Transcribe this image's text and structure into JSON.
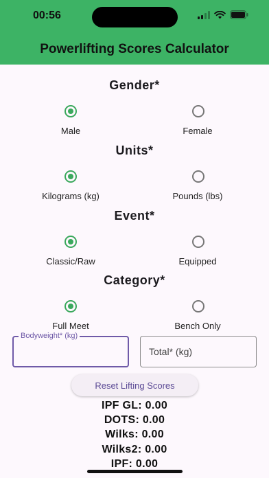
{
  "status": {
    "time": "00:56"
  },
  "app": {
    "title": "Powerlifting Scores Calculator"
  },
  "gender": {
    "title": "Gender*",
    "options": [
      "Male",
      "Female"
    ],
    "selected": "Male"
  },
  "units": {
    "title": "Units*",
    "options": [
      "Kilograms (kg)",
      "Pounds (lbs)"
    ],
    "selected": "Kilograms (kg)"
  },
  "event": {
    "title": "Event*",
    "options": [
      "Classic/Raw",
      "Equipped"
    ],
    "selected": "Classic/Raw"
  },
  "category": {
    "title": "Category*",
    "options": [
      "Full Meet",
      "Bench Only"
    ],
    "selected": "Full Meet"
  },
  "inputs": {
    "bodyweight": {
      "label": "Bodyweight* (kg)",
      "value": ""
    },
    "total": {
      "label": "Total* (kg)",
      "value": ""
    }
  },
  "reset_label": "Reset Lifting Scores",
  "scores": [
    "IPF GL: 0.00",
    "DOTS: 0.00",
    "Wilks: 0.00",
    "Wilks2: 0.00",
    "IPF: 0.00"
  ],
  "colors": {
    "header": "#3db365",
    "accent": "#3aa85c",
    "focus": "#6f5aa8"
  }
}
